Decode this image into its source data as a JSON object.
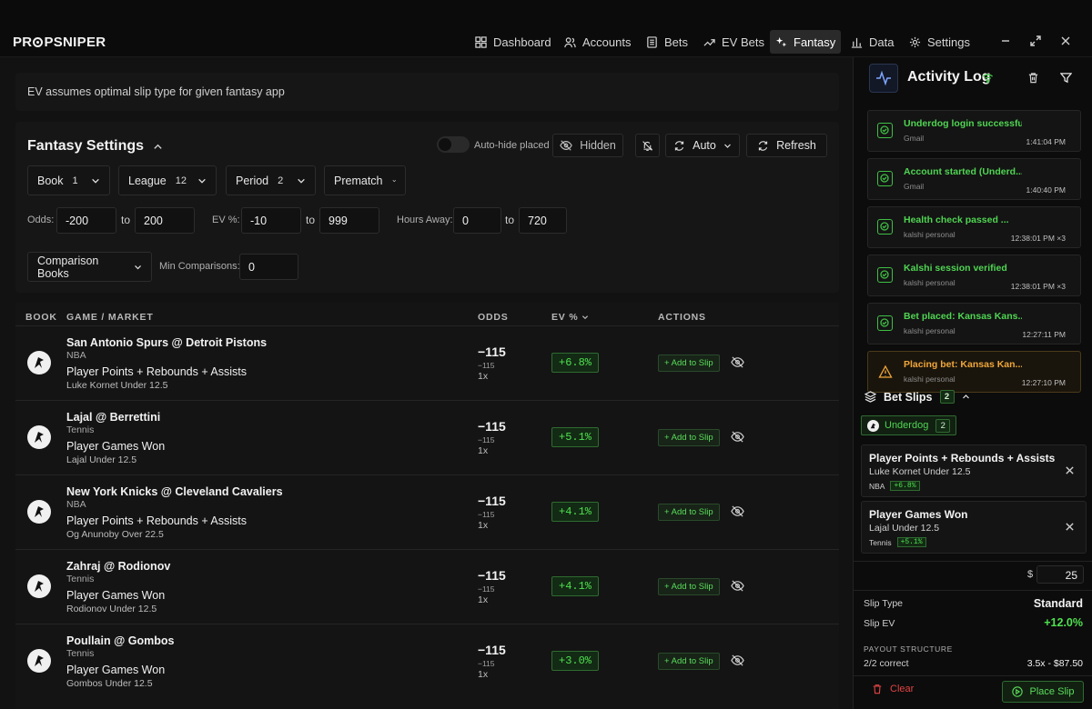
{
  "app": {
    "logo_left": "PR",
    "logo_right": "PSNIPER"
  },
  "nav": [
    {
      "label": "Dashboard",
      "icon": "grid-icon"
    },
    {
      "label": "Accounts",
      "icon": "users-icon"
    },
    {
      "label": "Bets",
      "icon": "receipt-icon"
    },
    {
      "label": "EV Bets",
      "icon": "trending-icon"
    },
    {
      "label": "Fantasy",
      "icon": "sparkles-icon",
      "active": true
    },
    {
      "label": "Data",
      "icon": "bar-chart-icon"
    },
    {
      "label": "Settings",
      "icon": "gear-icon"
    }
  ],
  "info": "EV assumes optimal slip type for given fantasy app",
  "settings": {
    "title": "Fantasy Settings",
    "auto_hide_label": "Auto-hide placed",
    "hidden_label": "Hidden",
    "auto_label": "Auto",
    "refresh_label": "Refresh",
    "book": {
      "label": "Book",
      "count": "1"
    },
    "league": {
      "label": "League",
      "count": "12"
    },
    "period": {
      "label": "Period",
      "count": "2"
    },
    "prematch": {
      "label": "Prematch"
    },
    "odds": {
      "label": "Odds:",
      "min": "-200",
      "max": "200"
    },
    "ev": {
      "label": "EV %:",
      "min": "-10",
      "max": "999"
    },
    "hours": {
      "label": "Hours Away:",
      "min": "0",
      "max": "720"
    },
    "to_label": "to",
    "comparison_books": "Comparison Books",
    "min_comparisons": {
      "label": "Min Comparisons:",
      "value": "0"
    }
  },
  "table": {
    "headers": {
      "book": "BOOK",
      "game": "GAME / MARKET",
      "odds": "ODDS",
      "ev": "EV %",
      "actions": "ACTIONS"
    },
    "add_label": "+ Add to Slip",
    "rows": [
      {
        "game": "San Antonio Spurs @ Detroit Pistons",
        "league": "NBA",
        "market": "Player Points + Rebounds + Assists",
        "pick": "Luke Kornet Under 12.5",
        "odds": "−115",
        "odds_sub": "−115",
        "mult": "1x",
        "ev": "+6.8%"
      },
      {
        "game": "Lajal @ Berrettini",
        "league": "Tennis",
        "market": "Player Games Won",
        "pick": "Lajal Under 12.5",
        "odds": "−115",
        "odds_sub": "−115",
        "mult": "1x",
        "ev": "+5.1%"
      },
      {
        "game": "New York Knicks @ Cleveland Cavaliers",
        "league": "NBA",
        "market": "Player Points + Rebounds + Assists",
        "pick": "Og Anunoby Over 22.5",
        "odds": "−115",
        "odds_sub": "−115",
        "mult": "1x",
        "ev": "+4.1%"
      },
      {
        "game": "Zahraj @ Rodionov",
        "league": "Tennis",
        "market": "Player Games Won",
        "pick": "Rodionov Under 12.5",
        "odds": "−115",
        "odds_sub": "−115",
        "mult": "1x",
        "ev": "+4.1%"
      },
      {
        "game": "Poullain @ Gombos",
        "league": "Tennis",
        "market": "Player Games Won",
        "pick": "Gombos Under 12.5",
        "odds": "−115",
        "odds_sub": "−115",
        "mult": "1x",
        "ev": "+3.0%"
      }
    ]
  },
  "activity": {
    "title": "Activity Log",
    "items": [
      {
        "title": "Underdog login successful",
        "sub": "Gmail",
        "time": "1:41:04 PM",
        "type": "success"
      },
      {
        "title": "Account started (Underd...",
        "sub": "Gmail",
        "time": "1:40:40 PM",
        "type": "success"
      },
      {
        "title": "Health check passed ...",
        "sub": "kalshi personal",
        "time": "12:38:01 PM ×3",
        "type": "success"
      },
      {
        "title": "Kalshi session verified",
        "sub": "kalshi personal",
        "time": "12:38:01 PM ×3",
        "type": "success"
      },
      {
        "title": "Bet placed: Kansas Kans...",
        "sub": "kalshi personal",
        "time": "12:27:11 PM",
        "type": "success"
      },
      {
        "title": "Placing bet: Kansas Kan...",
        "sub": "kalshi personal",
        "time": "12:27:10 PM",
        "type": "warning"
      }
    ]
  },
  "slips": {
    "title": "Bet Slips",
    "count": "2",
    "tab": {
      "label": "Underdog",
      "count": "2"
    },
    "cards": [
      {
        "market": "Player Points + Rebounds + Assists",
        "pick": "Luke Kornet Under 12.5",
        "league": "NBA",
        "ev": "+6.8%"
      },
      {
        "market": "Player Games Won",
        "pick": "Lajal Under 12.5",
        "league": "Tennis",
        "ev": "+5.1%"
      }
    ],
    "currency": "$",
    "stake": "25",
    "slip_type_label": "Slip Type",
    "slip_type": "Standard",
    "slip_ev_label": "Slip EV",
    "slip_ev": "+12.0%",
    "payout_label": "PAYOUT STRUCTURE",
    "payout_row_label": "2/2 correct",
    "payout_row_value": "3.5x - $87.50",
    "clear_label": "Clear",
    "place_label": "Place Slip"
  },
  "colors": {
    "accent_green": "#4ee04f",
    "warning": "#f0a63a",
    "danger": "#e04343"
  }
}
